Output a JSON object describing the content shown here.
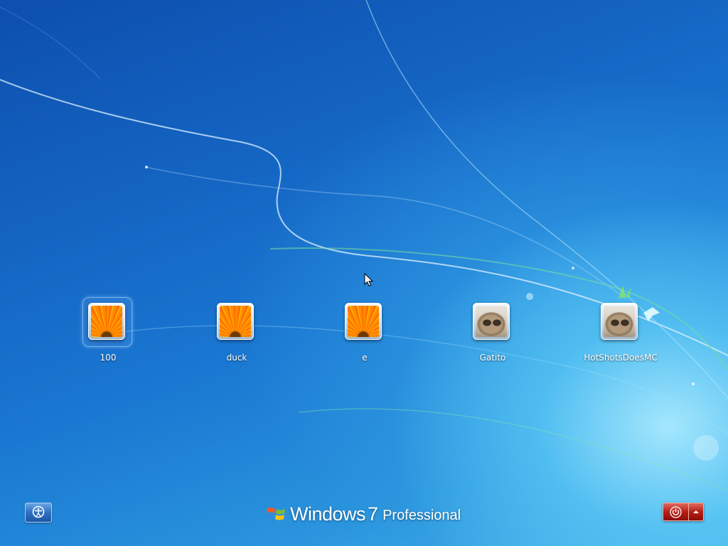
{
  "users": [
    {
      "name": "100",
      "picture": "flower-picture",
      "selected": true
    },
    {
      "name": "duck",
      "picture": "flower-picture",
      "selected": false
    },
    {
      "name": "e",
      "picture": "flower-picture",
      "selected": false
    },
    {
      "name": "Gatito",
      "picture": "kitten-picture",
      "selected": false
    },
    {
      "name": "HotShotsDoesMC",
      "picture": "kitten-picture",
      "selected": false
    }
  ],
  "branding": {
    "windows": "Windows",
    "version": "7",
    "edition": "Professional"
  },
  "buttons": {
    "ease_of_access": "ease-of-access-icon",
    "shutdown": "power-icon",
    "shutdown_options": "arrow-up-icon"
  },
  "colors": {
    "shutdown_red": "#b51f16",
    "background_blue": "#1a6fc8",
    "glow_cyan": "#aaebff"
  }
}
